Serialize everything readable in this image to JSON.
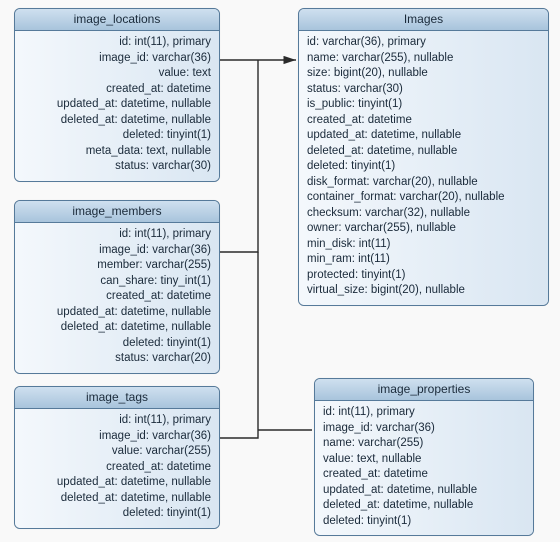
{
  "entities": [
    {
      "name": "image_locations",
      "fields": [
        "id: int(11), primary",
        "image_id: varchar(36)",
        "value: text",
        "created_at: datetime",
        "updated_at: datetime, nullable",
        "deleted_at: datetime, nullable",
        "deleted: tinyint(1)",
        "meta_data: text, nullable",
        "status: varchar(30)"
      ]
    },
    {
      "name": "Images",
      "fields": [
        "id: varchar(36), primary",
        "name: varchar(255), nullable",
        "size: bigint(20), nullable",
        "status: varchar(30)",
        "is_public: tinyint(1)",
        "created_at: datetime",
        "updated_at: datetime, nullable",
        "deleted_at: datetime, nullable",
        "deleted: tinyint(1)",
        "disk_format: varchar(20), nullable",
        "container_format: varchar(20), nullable",
        "checksum: varchar(32), nullable",
        "owner: varchar(255), nullable",
        "min_disk: int(11)",
        "min_ram: int(11)",
        "protected: tinyint(1)",
        "virtual_size: bigint(20), nullable"
      ]
    },
    {
      "name": "image_members",
      "fields": [
        "id: int(11), primary",
        "image_id: varchar(36)",
        "member: varchar(255)",
        "can_share: tiny_int(1)",
        "created_at: datetime",
        "updated_at: datetime, nullable",
        "deleted_at: datetime, nullable",
        "deleted: tinyint(1)",
        "status: varchar(20)"
      ]
    },
    {
      "name": "image_tags",
      "fields": [
        "id: int(11), primary",
        "image_id: varchar(36)",
        "value: varchar(255)",
        "created_at: datetime",
        "updated_at: datetime, nullable",
        "deleted_at: datetime, nullable",
        "deleted: tinyint(1)"
      ]
    },
    {
      "name": "image_properties",
      "fields": [
        "id: int(11), primary",
        "image_id: varchar(36)",
        "name: varchar(255)",
        "value: text, nullable",
        "created_at: datetime",
        "updated_at: datetime, nullable",
        "deleted_at: datetime, nullable",
        "deleted: tinyint(1)"
      ]
    }
  ],
  "relationships": [
    {
      "from": "image_locations.image_id",
      "to": "Images.id"
    },
    {
      "from": "image_members.image_id",
      "to": "Images.id"
    },
    {
      "from": "image_tags.image_id",
      "to": "Images.id"
    },
    {
      "from": "image_properties.image_id",
      "to": "Images.id"
    }
  ]
}
